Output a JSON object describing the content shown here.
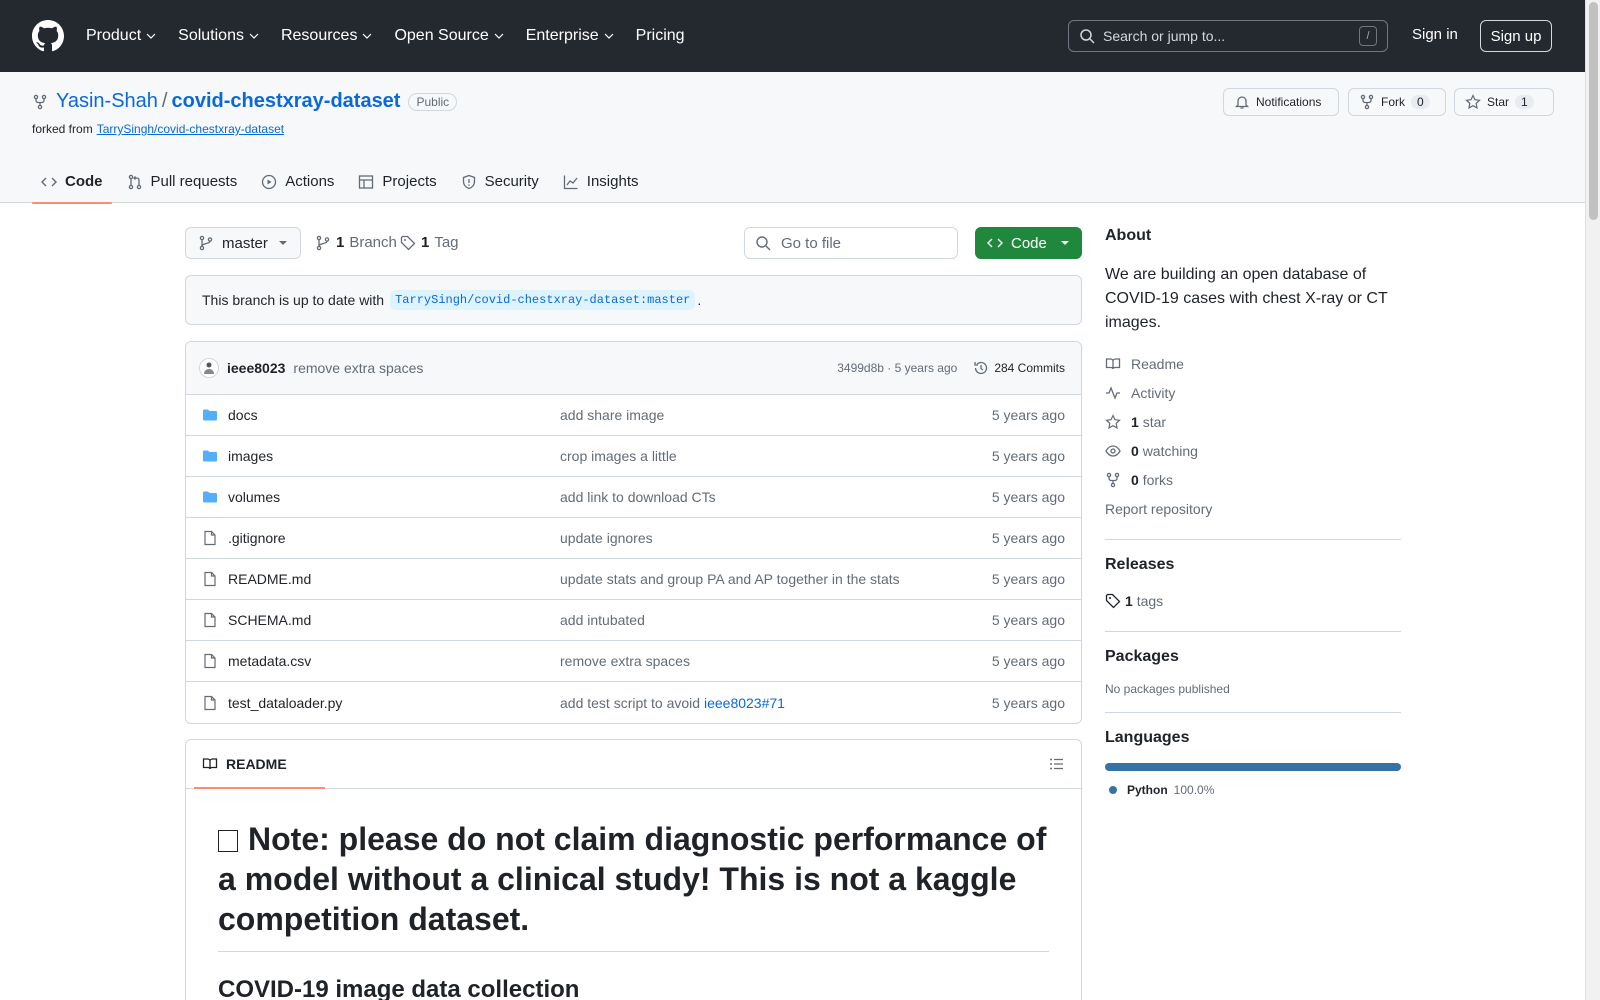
{
  "topnav": {
    "items": [
      "Product",
      "Solutions",
      "Resources",
      "Open Source",
      "Enterprise"
    ],
    "pricing": "Pricing",
    "search_placeholder": "Search or jump to...",
    "search_kbd": "/",
    "sign_in": "Sign in",
    "sign_up": "Sign up"
  },
  "repo": {
    "owner": "Yasin-Shah",
    "separator": "/",
    "name": "covid-chestxray-dataset",
    "visibility": "Public",
    "forked_prefix": "forked from",
    "forked_from": "TarrySingh/covid-chestxray-dataset",
    "notifications_label": "Notifications",
    "fork_label": "Fork",
    "fork_count": "0",
    "star_label": "Star",
    "star_count": "1"
  },
  "tabs": [
    "Code",
    "Pull requests",
    "Actions",
    "Projects",
    "Security",
    "Insights"
  ],
  "toolbar": {
    "branch": "master",
    "branch_count": "1",
    "branch_label": "Branch",
    "tag_count": "1",
    "tag_label": "Tag",
    "go_to_file": "Go to file",
    "code_button": "Code"
  },
  "branch_status": {
    "prefix": "This branch is up to date with",
    "ref": "TarrySingh/covid-chestxray-dataset:master",
    "suffix": "."
  },
  "latest_commit": {
    "author": "ieee8023",
    "message": "remove extra spaces",
    "meta": "3499d8b · 5 years ago",
    "commits": "284 Commits"
  },
  "files": [
    {
      "type": "folder",
      "name": "docs",
      "message": "add share image",
      "link": "",
      "age": "5 years ago"
    },
    {
      "type": "folder",
      "name": "images",
      "message": "crop images a little",
      "link": "",
      "age": "5 years ago"
    },
    {
      "type": "folder",
      "name": "volumes",
      "message": "add link to download CTs",
      "link": "",
      "age": "5 years ago"
    },
    {
      "type": "file",
      "name": ".gitignore",
      "message": "update ignores",
      "link": "",
      "age": "5 years ago"
    },
    {
      "type": "file",
      "name": "README.md",
      "message": "update stats and group PA and AP together in the stats",
      "link": "",
      "age": "5 years ago"
    },
    {
      "type": "file",
      "name": "SCHEMA.md",
      "message": "add intubated",
      "link": "",
      "age": "5 years ago"
    },
    {
      "type": "file",
      "name": "metadata.csv",
      "message": "remove extra spaces",
      "link": "",
      "age": "5 years ago"
    },
    {
      "type": "file",
      "name": "test_dataloader.py",
      "message": "add test script to avoid ",
      "link": "ieee8023#71",
      "age": "5 years ago"
    }
  ],
  "readme": {
    "tab": "README",
    "h1": "Note: please do not claim diagnostic performance of a model without a clinical study! This is not a kaggle competition dataset.",
    "h2": "COVID-19 image data collection"
  },
  "about": {
    "title": "About",
    "description": "We are building an open database of COVID-19 cases with chest X-ray or CT images.",
    "readme": "Readme",
    "activity": "Activity",
    "stars_count": "1",
    "stars_label": "star",
    "watching_count": "0",
    "watching_label": "watching",
    "forks_count": "0",
    "forks_label": "forks",
    "report": "Report repository"
  },
  "releases": {
    "title": "Releases",
    "tags_count": "1",
    "tags_label": "tags"
  },
  "packages": {
    "title": "Packages",
    "empty": "No packages published"
  },
  "languages": {
    "title": "Languages",
    "items": [
      {
        "name": "Python",
        "percent": "100.0%",
        "color": "#3572A5"
      }
    ]
  }
}
